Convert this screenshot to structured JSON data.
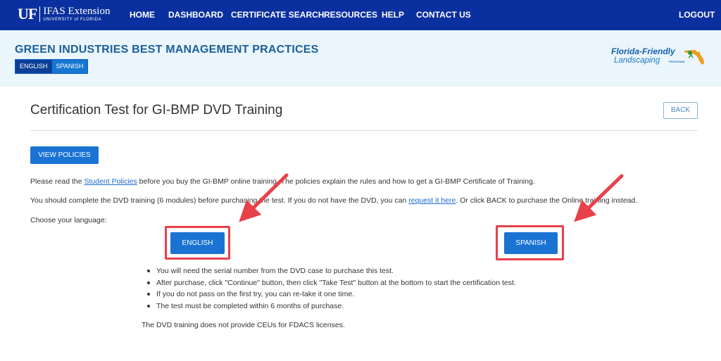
{
  "nav": {
    "logo_uf": "UF",
    "logo_main": "IFAS Extension",
    "logo_sub": "UNIVERSITY of FLORIDA",
    "items": [
      "HOME",
      "DASHBOARD",
      "CERTIFICATE SEARCH",
      "RESOURCES",
      "HELP",
      "CONTACT US"
    ],
    "logout": "LOGOUT"
  },
  "header": {
    "title": "GREEN INDUSTRIES BEST MANAGEMENT PRACTICES",
    "lang_english": "ENGLISH",
    "lang_spanish": "SPANISH",
    "ffl_line1": "Florida-Friendly",
    "ffl_line2": "Landscaping",
    "ffl_tag": "PROGRAM"
  },
  "main": {
    "heading": "Certification Test for GI-BMP DVD Training",
    "back_label": "BACK",
    "view_policies_label": "VIEW POLICIES",
    "para1_before": "Please read the ",
    "para1_link": "Student Policies",
    "para1_after": " before you buy the GI-BMP online training. The policies explain the rules and how to get a GI-BMP Certificate of Training.",
    "para2_before": "You should complete the DVD training (6 modules) before purchasing the test. If you do not have the DVD, you can ",
    "para2_link": "request it here",
    "para2_after": ". Or click BACK to purchase the Online training instead.",
    "choose_language": "Choose your language:",
    "english_button": "ENGLISH",
    "spanish_button": "SPANISH",
    "bullets": [
      "You will need the serial number from the DVD case to purchase this test.",
      "After purchase, click \"Continue\" button, then click \"Take Test\" button at the bottom to start the certification test.",
      "If you do not pass on the first try, you can re-take it one time.",
      "The test must be completed within 6 months of purchase."
    ],
    "note": "The DVD training does not provide CEUs for FDACS licenses."
  },
  "colors": {
    "nav_bg": "#0a2f9e",
    "header_bg": "#eaf5fc",
    "title_blue": "#1c5f99",
    "button_blue": "#1a73d3",
    "highlight_red": "#e8414a"
  }
}
